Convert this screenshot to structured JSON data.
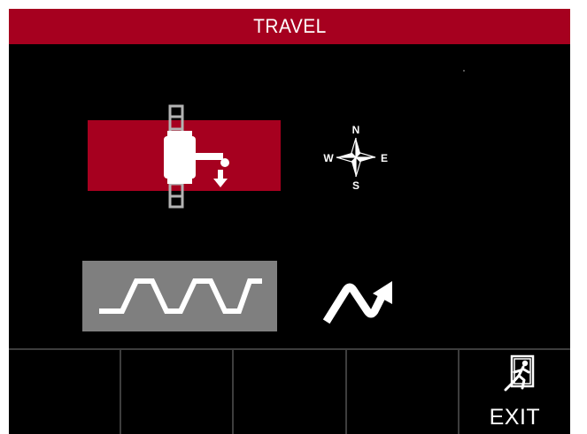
{
  "screen": {
    "title": "TRAVEL"
  },
  "main": {
    "travel_mode": {
      "icon": "travel-carriage-icon",
      "selected": true
    },
    "direction": {
      "icon": "compass-icon",
      "north": "N",
      "south": "S",
      "east": "E",
      "west": "W"
    },
    "weave_mode": {
      "icon": "weave-pattern-icon",
      "selected": false
    },
    "oscillation": {
      "icon": "wave-arrow-icon"
    }
  },
  "softkeys": [
    {
      "label": "",
      "icon": ""
    },
    {
      "label": "",
      "icon": ""
    },
    {
      "label": "",
      "icon": ""
    },
    {
      "label": "",
      "icon": ""
    },
    {
      "label": "EXIT",
      "icon": "exit-running-man-icon"
    }
  ],
  "colors": {
    "accent": "#a6001f",
    "selected_gray": "#7f7f7f",
    "background": "#000000",
    "divider": "#3d3d3d"
  }
}
